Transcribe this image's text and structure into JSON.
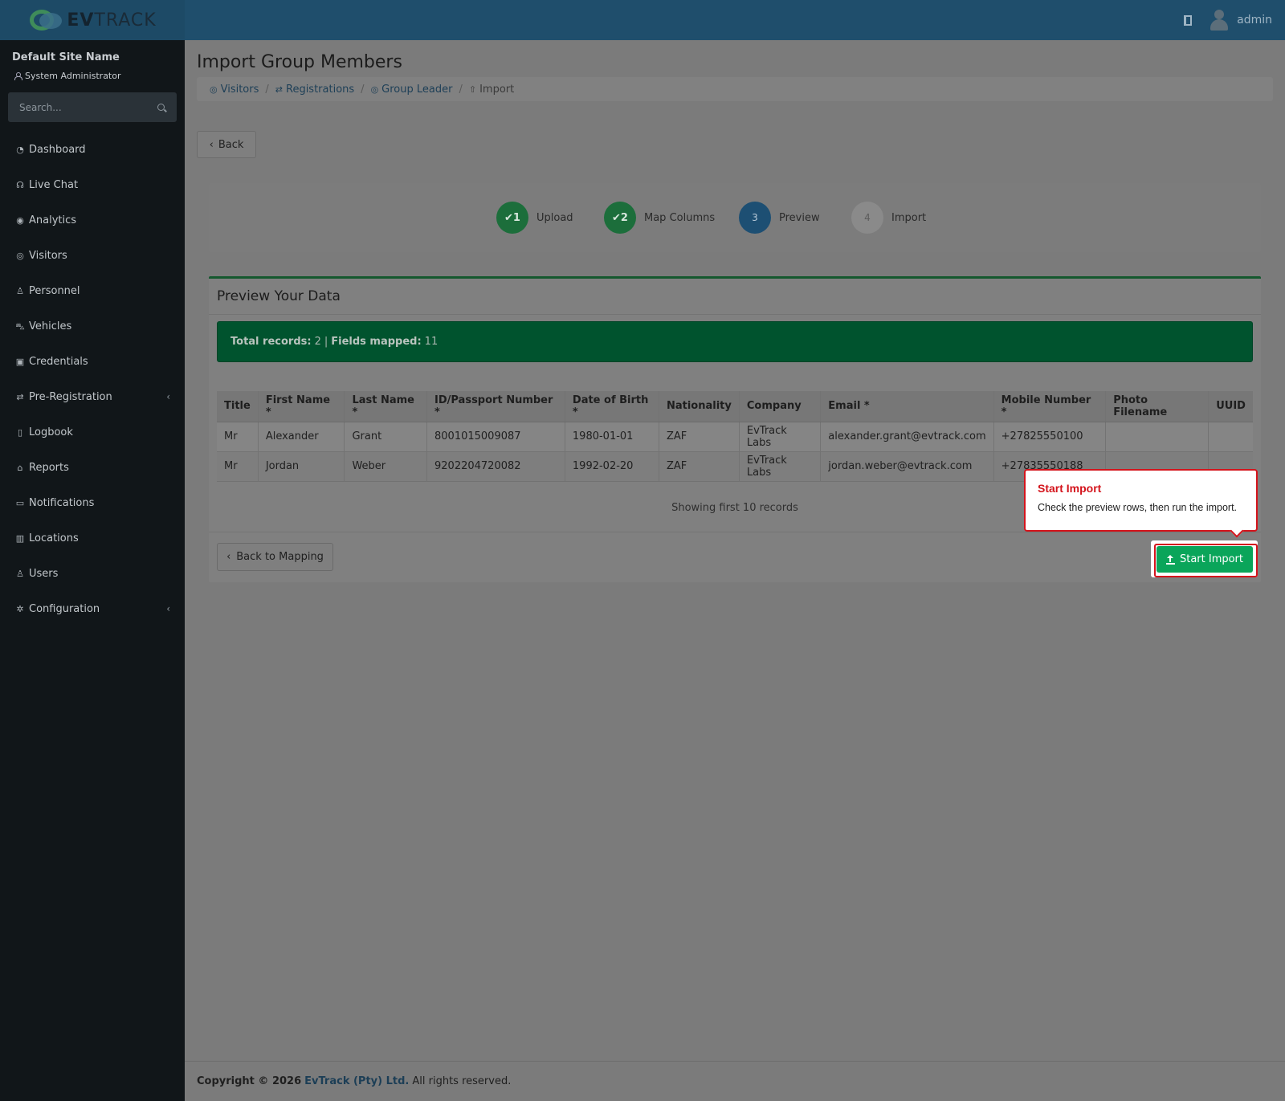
{
  "header": {
    "logo_text_bold": "EV",
    "logo_text": "TRACK",
    "user_name": "admin"
  },
  "sidebar": {
    "site_name": "Default Site Name",
    "role": "System Administrator",
    "search_placeholder": "Search...",
    "items": [
      {
        "label": "Dashboard",
        "icon": "dashboard-icon"
      },
      {
        "label": "Live Chat",
        "icon": "headset-icon"
      },
      {
        "label": "Analytics",
        "icon": "target-icon"
      },
      {
        "label": "Visitors",
        "icon": "eye-icon"
      },
      {
        "label": "Personnel",
        "icon": "user-tie-icon"
      },
      {
        "label": "Vehicles",
        "icon": "car-icon"
      },
      {
        "label": "Credentials",
        "icon": "id-card-icon"
      },
      {
        "label": "Pre-Registration",
        "icon": "exchange-icon"
      },
      {
        "label": "Logbook",
        "icon": "book-icon"
      },
      {
        "label": "Reports",
        "icon": "chart-icon"
      },
      {
        "label": "Notifications",
        "icon": "comments-icon"
      },
      {
        "label": "Locations",
        "icon": "building-icon"
      },
      {
        "label": "Users",
        "icon": "user-cog-icon"
      },
      {
        "label": "Configuration",
        "icon": "cog-icon"
      }
    ]
  },
  "page": {
    "title": "Import Group Members",
    "breadcrumb": {
      "visitors": "Visitors",
      "registrations": "Registrations",
      "group_leader": "Group Leader",
      "import": "Import"
    },
    "back_label": "Back"
  },
  "wizard": {
    "steps": [
      {
        "number": "1",
        "label": "Upload",
        "state": "done"
      },
      {
        "number": "2",
        "label": "Map Columns",
        "state": "done"
      },
      {
        "number": "3",
        "label": "Preview",
        "state": "active"
      },
      {
        "number": "4",
        "label": "Import",
        "state": "pending"
      }
    ]
  },
  "preview": {
    "title": "Preview Your Data",
    "total_label": "Total records:",
    "total_value": "2",
    "mapped_label": "Fields mapped:",
    "mapped_value": "11",
    "columns": [
      "Title",
      "First Name *",
      "Last Name *",
      "ID/Passport Number *",
      "Date of Birth *",
      "Nationality",
      "Company",
      "Email *",
      "Mobile Number *",
      "Photo Filename",
      "UUID"
    ],
    "rows": [
      [
        "Mr",
        "Alexander",
        "Grant",
        "8001015009087",
        "1980-01-01",
        "ZAF",
        "EvTrack Labs",
        "alexander.grant@evtrack.com",
        "+27825550100",
        "",
        ""
      ],
      [
        "Mr",
        "Jordan",
        "Weber",
        "9202204720082",
        "1992-02-20",
        "ZAF",
        "EvTrack Labs",
        "jordan.weber@evtrack.com",
        "+27835550188",
        "",
        ""
      ]
    ],
    "showing": "Showing first 10 records",
    "back_to_mapping": "Back to Mapping",
    "start_import": "Start Import"
  },
  "tooltip": {
    "title": "Start Import",
    "body": "Check the preview rows, then run the import."
  },
  "footer": {
    "copyright": "Copyright © 2026",
    "company": "EvTrack (Pty) Ltd.",
    "rights": "All rights reserved."
  },
  "colors": {
    "header": "#1f4e6c",
    "sidebar": "#111619",
    "success": "#0aa55a",
    "highlight": "#d4141c"
  }
}
